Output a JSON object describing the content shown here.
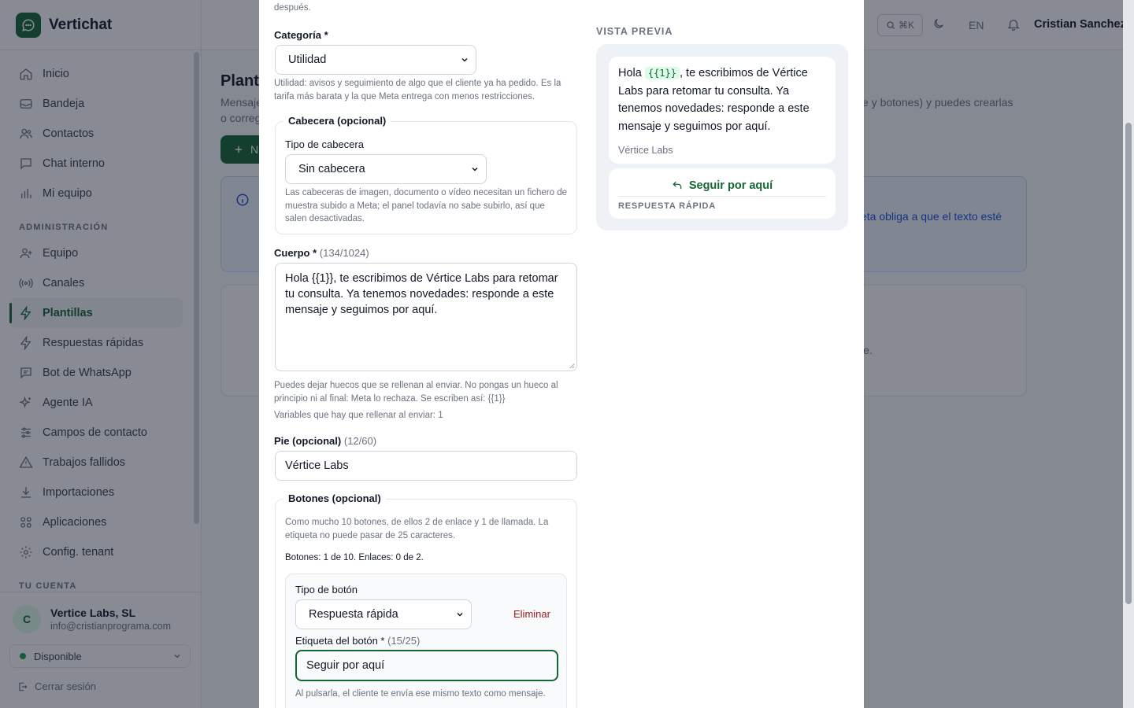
{
  "brand": {
    "name": "Vertichat"
  },
  "sidebar": {
    "items": [
      {
        "label": "Inicio",
        "icon": "home-icon"
      },
      {
        "label": "Bandeja",
        "icon": "inbox-icon"
      },
      {
        "label": "Contactos",
        "icon": "users-icon"
      },
      {
        "label": "Chat interno",
        "icon": "chat-icon"
      },
      {
        "label": "Mi equipo",
        "icon": "bar-chart-icon"
      }
    ],
    "admin_section": "ADMINISTRACIÓN",
    "admin_items": [
      {
        "label": "Equipo",
        "icon": "user-plus-icon"
      },
      {
        "label": "Canales",
        "icon": "radio-icon"
      },
      {
        "label": "Plantillas",
        "icon": "bolt-icon",
        "active": true
      },
      {
        "label": "Respuestas rápidas",
        "icon": "bolt-icon"
      },
      {
        "label": "Bot de WhatsApp",
        "icon": "chat-icon"
      },
      {
        "label": "Agente IA",
        "icon": "sparkles-icon"
      },
      {
        "label": "Campos de contacto",
        "icon": "sliders-icon"
      },
      {
        "label": "Trabajos fallidos",
        "icon": "warning-icon"
      },
      {
        "label": "Importaciones",
        "icon": "download-icon"
      },
      {
        "label": "Aplicaciones",
        "icon": "grid-icon"
      },
      {
        "label": "Config. tenant",
        "icon": "gear-icon"
      }
    ],
    "account_section": "TU CUENTA"
  },
  "account": {
    "initial": "C",
    "name": "Vertice Labs, SL",
    "email": "info@cristianprograma.com",
    "status": "Disponible",
    "logout": "Cerrar sesión"
  },
  "topbar": {
    "search_shortcut": "⌘K",
    "lang": "EN",
    "user": "Cristian Sanchez"
  },
  "background": {
    "title": "Planti",
    "desc_left_1": "Mensaje",
    "desc_left_2": "o correg",
    "desc_right": "e y botones) y puedes crearlas",
    "new_button": "N",
    "info_text": "eta obliga a que el texto esté",
    "empty_text": "je."
  },
  "form": {
    "top_fragment": "después.",
    "category_label": "Categoría *",
    "category_value": "Utilidad",
    "category_help": "Utilidad: avisos y seguimiento de algo que el cliente ya ha pedido. Es la tarifa más barata y la que Meta entrega con menos restricciones.",
    "header_legend": "Cabecera (opcional)",
    "header_type_label": "Tipo de cabecera",
    "header_type_value": "Sin cabecera",
    "header_help": "Las cabeceras de imagen, documento o vídeo necesitan un fichero de muestra subido a Meta; el panel todavía no sabe subirlo, así que salen desactivadas.",
    "body_label": "Cuerpo *",
    "body_count": "(134/1024)",
    "body_value": "Hola {{1}}, te escribimos de Vértice Labs para retomar tu consulta. Ya tenemos novedades: responde a este mensaje y seguimos por aquí.",
    "body_help": "Puedes dejar huecos que se rellenan al enviar. No pongas un hueco al principio ni al final: Meta lo rechaza. Se escriben así: {{1}}",
    "body_vars": "Variables que hay que rellenar al enviar: 1",
    "footer_label": "Pie (opcional)",
    "footer_count": "(12/60)",
    "footer_value": "Vértice Labs",
    "buttons_legend": "Botones (opcional)",
    "buttons_help": "Como mucho 10 botones, de ellos 2 de enlace y 1 de llamada. La etiqueta no puede pasar de 25 caracteres.",
    "buttons_count": "Botones: 1 de 10. Enlaces: 0 de 2.",
    "button_type_label": "Tipo de botón",
    "button_type_value": "Respuesta rápida",
    "button_remove": "Eliminar",
    "button_label_label": "Etiqueta del botón *",
    "button_label_count": "(15/25)",
    "button_label_value": "Seguir por aquí",
    "button_label_help": "Al pulsarla, el cliente te envía ese mismo texto como mensaje."
  },
  "preview": {
    "title": "VISTA PREVIA",
    "body_before": "Hola ",
    "body_var": "{{1}}",
    "body_after": ", te escribimos de Vértice Labs para retomar tu consulta. Ya tenemos novedades: responde a este mensaje y seguimos por aquí.",
    "footer": "Vértice Labs",
    "quick_reply": "Seguir por aquí",
    "quick_reply_label": "RESPUESTA RÁPIDA"
  }
}
